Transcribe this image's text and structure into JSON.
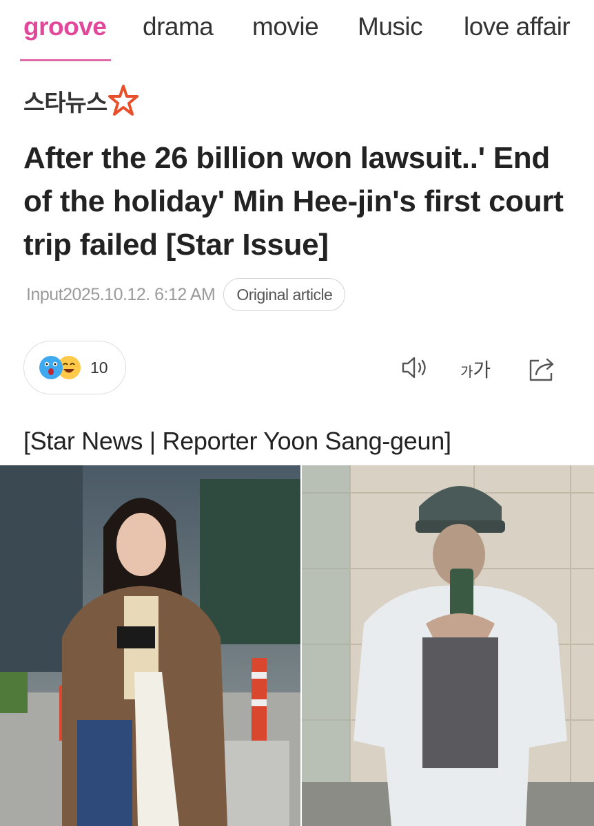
{
  "nav": {
    "tabs": [
      {
        "label": "groove",
        "active": true
      },
      {
        "label": "drama",
        "active": false
      },
      {
        "label": "movie",
        "active": false
      },
      {
        "label": "Music",
        "active": false
      },
      {
        "label": "love affair",
        "active": false
      }
    ],
    "accent_color": "#e1489a"
  },
  "publisher": {
    "name": "스타뉴스",
    "logo_icon": "star-icon"
  },
  "article": {
    "headline": "After the 26 billion won lawsuit..' End of the holiday' Min Hee-jin's first court trip failed [Star Issue]",
    "input_time": "Input2025.10.12. 6:12 AM",
    "original_article_label": "Original article",
    "byline": "[Star News | Reporter Yoon Sang-geun]"
  },
  "reactions": {
    "count": "10",
    "icons": [
      "shocked-emoji-icon",
      "laughing-emoji-icon"
    ]
  },
  "tools": {
    "font_size_small": "가",
    "font_size_large": "가",
    "icons": [
      "speaker-icon",
      "font-size-icon",
      "share-icon"
    ]
  }
}
